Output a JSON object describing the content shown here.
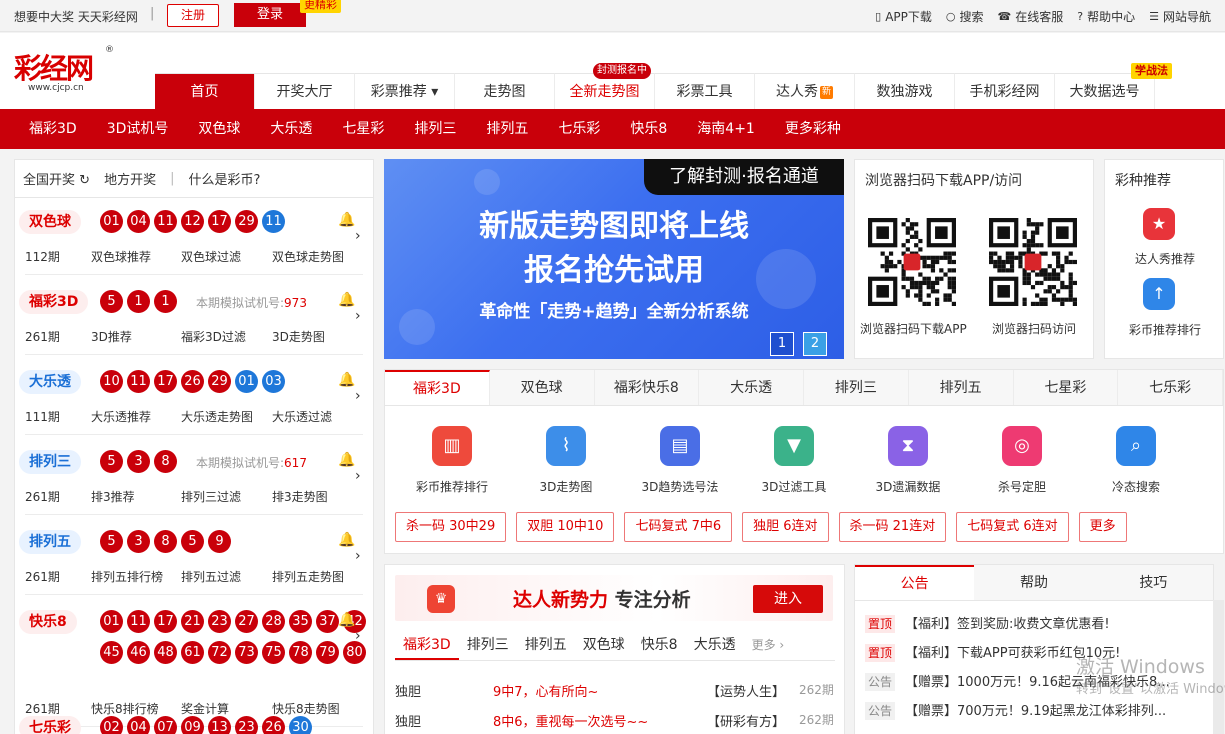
{
  "topbar": {
    "slogan": "想要中大奖 天天彩经网",
    "sep": "|",
    "register": "注册",
    "login": "登录",
    "more_badge": "更精彩",
    "links": [
      {
        "icon": "phone-icon",
        "glyph": "▯",
        "label": "APP下载"
      },
      {
        "icon": "search-icon",
        "glyph": "○",
        "label": "搜索"
      },
      {
        "icon": "service-icon",
        "glyph": "☎",
        "label": "在线客服"
      },
      {
        "icon": "help-icon",
        "glyph": "?",
        "label": "帮助中心"
      },
      {
        "icon": "sitemap-icon",
        "glyph": "☰",
        "label": "网站导航"
      }
    ]
  },
  "logo": {
    "text": "彩经网",
    "reg": "®",
    "url": "www.cjcp.cn"
  },
  "mainnav": {
    "items": [
      "首页",
      "开奖大厅",
      "彩票推荐",
      "走势图",
      "全新走势图",
      "彩票工具",
      "达人秀",
      "数独游戏",
      "手机彩经网",
      "大数据选号"
    ],
    "caret": "▾",
    "tag_new": "封测报名中",
    "tag_learn": "学战法",
    "hot": "新"
  },
  "subnav": [
    "福彩3D",
    "3D试机号",
    "双色球",
    "大乐透",
    "七星彩",
    "排列三",
    "排列五",
    "七乐彩",
    "快乐8",
    "海南4+1",
    "更多彩种"
  ],
  "left": {
    "head": {
      "tab1": "全国开奖",
      "refresh": "↻",
      "tab2": "地方开奖",
      "sep": "|",
      "tab3": "什么是彩币?"
    },
    "bell": "🔔",
    "arrow": "›",
    "lotteries": [
      {
        "name": "双色球",
        "red": [
          "01",
          "04",
          "11",
          "12",
          "17",
          "29"
        ],
        "blue": [
          "11"
        ],
        "issue": "112期",
        "links": [
          "双色球推荐",
          "双色球过滤",
          "双色球走势图"
        ]
      },
      {
        "name": "福彩3D",
        "red": [
          "5",
          "1",
          "1"
        ],
        "blue": [],
        "sim_label": "本期模拟试机号:",
        "sim_value": "973",
        "issue": "261期",
        "links": [
          "3D推荐",
          "福彩3D过滤",
          "3D走势图"
        ]
      },
      {
        "name": "大乐透",
        "red": [
          "10",
          "11",
          "17",
          "26",
          "29"
        ],
        "blue": [
          "01",
          "03"
        ],
        "issue": "111期",
        "links": [
          "大乐透推荐",
          "大乐透走势图",
          "大乐透过滤"
        ]
      },
      {
        "name": "排列三",
        "red": [
          "5",
          "3",
          "8"
        ],
        "blue": [],
        "sim_label": "本期模拟试机号:",
        "sim_value": "617",
        "issue": "261期",
        "links": [
          "排3推荐",
          "排列三过滤",
          "排3走势图"
        ]
      },
      {
        "name": "排列五",
        "red": [
          "5",
          "3",
          "8",
          "5",
          "9"
        ],
        "blue": [],
        "issue": "261期",
        "links": [
          "排列五排行榜",
          "排列五过滤",
          "排列五走势图"
        ]
      },
      {
        "name": "快乐8",
        "red": [
          "01",
          "11",
          "17",
          "21",
          "23",
          "27",
          "28",
          "35",
          "37",
          "42",
          "45",
          "46",
          "48",
          "61",
          "72",
          "73",
          "75",
          "78",
          "79",
          "80"
        ],
        "blue": [],
        "issue": "261期",
        "links": [
          "快乐8排行榜",
          "奖金计算",
          "快乐8走势图"
        ]
      },
      {
        "name": "七乐彩",
        "red": [
          "02",
          "04",
          "07",
          "09",
          "13",
          "23",
          "26"
        ],
        "blue": [
          "30"
        ],
        "issue": "",
        "links": []
      }
    ]
  },
  "banner": {
    "tag": "了解封测·报名通道",
    "h1": "新版走势图即将上线",
    "h2": "报名抢先试用",
    "h3": "革命性「走势+趋势」全新分析系统",
    "pages": [
      "1",
      "2"
    ]
  },
  "qr": {
    "title": "浏览器扫码下载APP/访问",
    "cap1": "浏览器扫码下载APP",
    "cap2": "浏览器扫码访问"
  },
  "rec": {
    "title": "彩种推荐",
    "items": [
      {
        "label": "达人秀推荐",
        "glyph": "★",
        "color": "#e8343a"
      },
      {
        "label": "彩币推荐排行",
        "glyph": "↑",
        "color": "#2f86e8"
      }
    ]
  },
  "tools": {
    "tabs": [
      "福彩3D",
      "双色球",
      "福彩快乐8",
      "大乐透",
      "排列三",
      "排列五",
      "七星彩",
      "七乐彩"
    ],
    "items": [
      {
        "label": "彩币推荐排行",
        "glyph": "▥",
        "color": "#ee4a3c"
      },
      {
        "label": "3D走势图",
        "glyph": "⌇",
        "color": "#3d8ee9"
      },
      {
        "label": "3D趋势选号法",
        "glyph": "▤",
        "color": "#4a6ee6"
      },
      {
        "label": "3D过滤工具",
        "glyph": "▼",
        "color": "#3bb28a"
      },
      {
        "label": "3D遗漏数据",
        "glyph": "⧗",
        "color": "#8a62e6"
      },
      {
        "label": "杀号定胆",
        "glyph": "◎",
        "color": "#ee3a72"
      },
      {
        "label": "冷态搜索",
        "glyph": "⌕",
        "color": "#2f86e8"
      }
    ],
    "pills": [
      "杀一码 30中29",
      "双胆 10中10",
      "七码复式 7中6",
      "独胆 6连对",
      "杀一码 21连对",
      "七码复式 6连对",
      "更多"
    ]
  },
  "expert": {
    "banner_a": "达人新势力",
    "banner_b": "专注分析",
    "go": "进入",
    "tabs": [
      "福彩3D",
      "排列三",
      "排列五",
      "双色球",
      "快乐8",
      "大乐透"
    ],
    "more": "更多 ›",
    "rows": [
      {
        "type": "独胆",
        "title": "9中7，心有所向~",
        "author": "【运势人生】",
        "issue": "262期"
      },
      {
        "type": "独胆",
        "title": "8中6，重视每一次选号~~",
        "author": "【研彩有方】",
        "issue": "262期"
      }
    ]
  },
  "news": {
    "tabs": [
      "公告",
      "帮助",
      "技巧"
    ],
    "rows": [
      {
        "tag": "置顶",
        "text": "【福利】签到奖励:收费文章优惠看!",
        "hot": true
      },
      {
        "tag": "置顶",
        "text": "【福利】下载APP可获彩币红包10元!",
        "hot": true
      },
      {
        "tag": "公告",
        "text": "【赠票】1000万元！9.16起云南福彩快乐8...",
        "hot": false
      },
      {
        "tag": "公告",
        "text": "【赠票】700万元！9.19起黑龙江体彩排列...",
        "hot": false
      }
    ]
  },
  "watermark": {
    "line1": "激活 Windows",
    "line2": "转到\"设置\"以激活 Windows。"
  }
}
